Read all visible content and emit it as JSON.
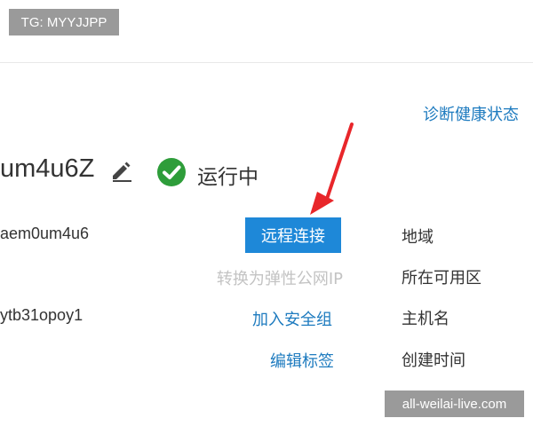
{
  "overlay": {
    "tg_badge": "TG: MYYJJPP",
    "watermark": "all-weilai-live.com"
  },
  "header": {
    "diagnose_link": "诊断健康状态"
  },
  "instance": {
    "name": "um4u6Z",
    "status": "运行中",
    "id_value": "aem0um4u6",
    "second_value": "ytb31opoy1"
  },
  "actions": {
    "remote_connect": "远程连接",
    "convert_eip": "转换为弹性公网IP",
    "join_security_group": "加入安全组",
    "edit_tags": "编辑标签"
  },
  "fields": {
    "region": "地域",
    "zone": "所在可用区",
    "hostname": "主机名",
    "created_time": "创建时间"
  },
  "icons": {
    "edit": "pencil-icon",
    "status": "check-circle-icon",
    "annotation": "red-arrow-icon"
  },
  "colors": {
    "status_green": "#2e9d3a",
    "link_blue": "#1e7bbf",
    "button_blue": "#1e88d8",
    "disabled_gray": "#c3c3c3",
    "annotation_red": "#e8262a"
  }
}
